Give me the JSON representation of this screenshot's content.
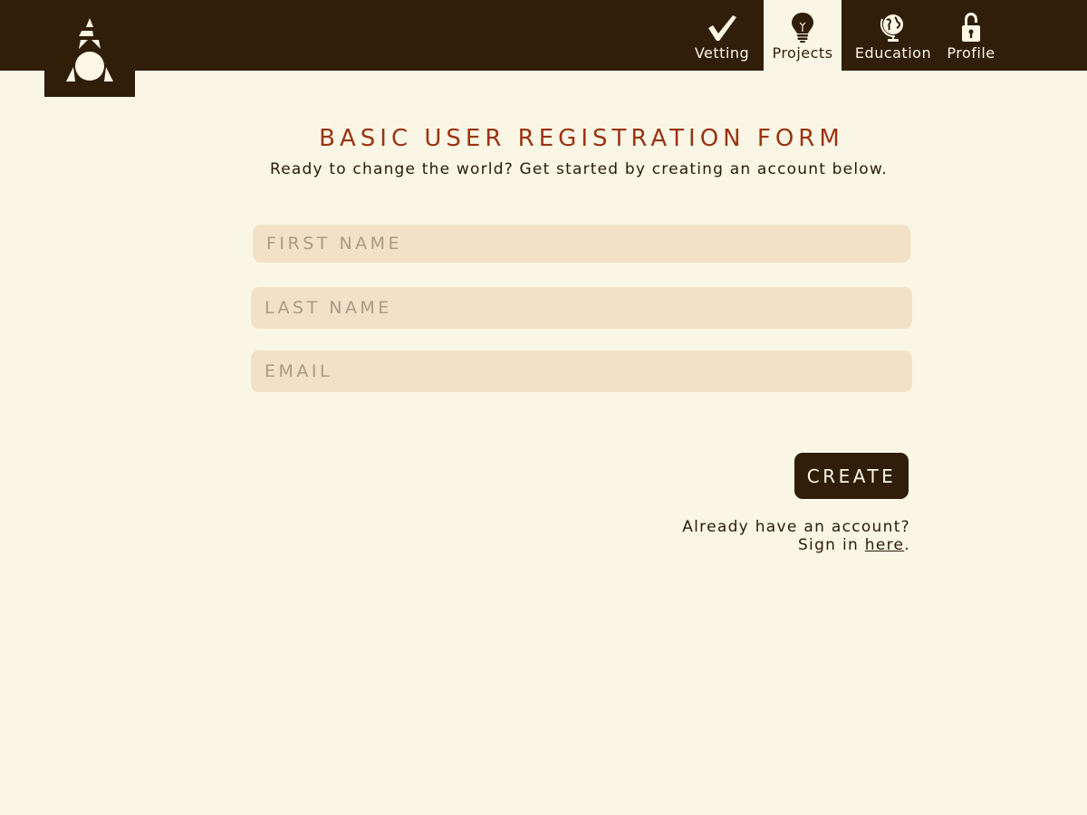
{
  "header": {
    "logo_icon": "triangle-circle-logo-icon",
    "nav": [
      {
        "label": "Vetting",
        "icon": "checkmark-icon",
        "active": false
      },
      {
        "label": "Projects",
        "icon": "lightbulb-icon",
        "active": true
      },
      {
        "label": "Education",
        "icon": "globe-icon",
        "active": false
      },
      {
        "label": "Profile",
        "icon": "lock-icon",
        "active": false
      }
    ]
  },
  "form": {
    "title": "BASIC USER REGISTRATION FORM",
    "subtitle": "Ready to change the world? Get started by creating an account below.",
    "first_name_placeholder": "FIRST NAME",
    "last_name_placeholder": "LAST NAME",
    "email_placeholder": "EMAIL",
    "create_label": "CREATE"
  },
  "signin": {
    "line1": "Already have an account?",
    "line2_prefix": "Sign in ",
    "link_text": "here",
    "line2_suffix": "."
  },
  "colors": {
    "header_bg": "#311e08",
    "page_bg": "#faf6e6",
    "title": "#9a3412",
    "field_bg": "#f2e1c7"
  }
}
